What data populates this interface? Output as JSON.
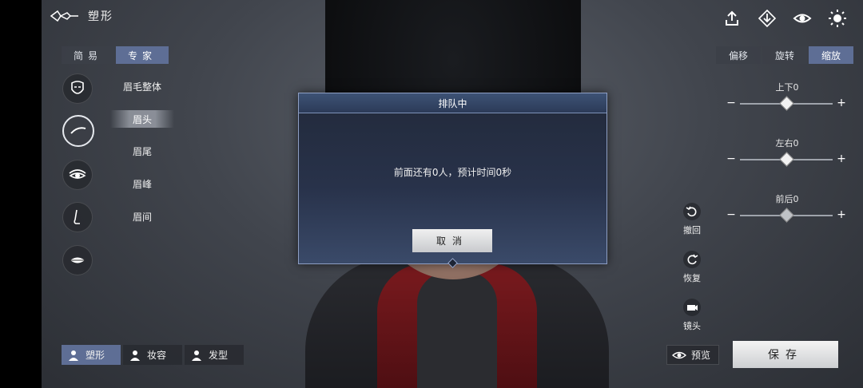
{
  "header": {
    "title": "塑形"
  },
  "mode_tabs": [
    {
      "label": "简易",
      "active": false
    },
    {
      "label": "专家",
      "active": true
    }
  ],
  "categories": [
    {
      "icon": "face-icon"
    },
    {
      "icon": "eyebrow-icon",
      "active": true
    },
    {
      "icon": "eye-icon"
    },
    {
      "icon": "nose-icon"
    },
    {
      "icon": "mouth-icon"
    }
  ],
  "parts": [
    {
      "label": "眉毛整体"
    },
    {
      "label": "眉头",
      "active": true
    },
    {
      "label": "眉尾"
    },
    {
      "label": "眉峰"
    },
    {
      "label": "眉间"
    }
  ],
  "top_icons": [
    "upload-icon",
    "download-icon",
    "eye-view-icon",
    "brightness-icon"
  ],
  "transform_tabs": [
    {
      "label": "偏移",
      "active": false
    },
    {
      "label": "旋转",
      "active": false
    },
    {
      "label": "缩放",
      "active": true
    }
  ],
  "sliders": [
    {
      "label": "上下0",
      "value": 0
    },
    {
      "label": "左右0",
      "value": 0
    },
    {
      "label": "前后0",
      "value": 0
    }
  ],
  "side_actions": [
    {
      "label": "撤回",
      "icon": "undo-icon"
    },
    {
      "label": "恢复",
      "icon": "restore-icon"
    },
    {
      "label": "镜头",
      "icon": "camera-icon"
    }
  ],
  "bottom_tabs": [
    {
      "label": "塑形",
      "active": true
    },
    {
      "label": "妆容",
      "active": false
    },
    {
      "label": "发型",
      "active": false
    }
  ],
  "preview_label": "预览",
  "save_label": "保存",
  "dialog": {
    "title": "排队中",
    "message": "前面还有0人，预计时间0秒",
    "cancel_label": "取消"
  }
}
